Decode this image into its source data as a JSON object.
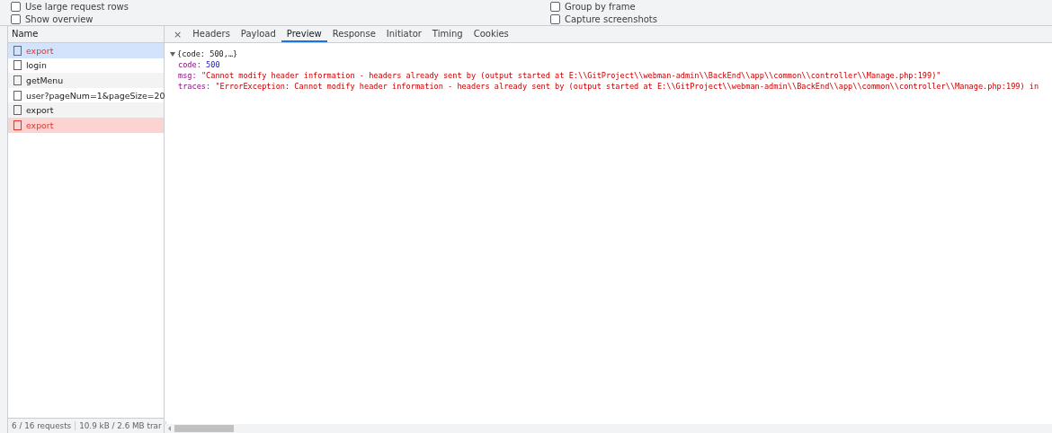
{
  "options": [
    {
      "label": "Use large request rows",
      "checked": false
    },
    {
      "label": "Group by frame",
      "checked": false
    },
    {
      "label": "Show overview",
      "checked": false
    },
    {
      "label": "Capture screenshots",
      "checked": false
    }
  ],
  "requests": {
    "header": "Name",
    "rows": [
      {
        "name": "export",
        "failed": true,
        "selected": true
      },
      {
        "name": "login",
        "failed": false,
        "selected": false
      },
      {
        "name": "getMenu",
        "failed": false,
        "selected": false
      },
      {
        "name": "user?pageNum=1&pageSize=20",
        "failed": false,
        "selected": false
      },
      {
        "name": "export",
        "failed": false,
        "selected": false
      },
      {
        "name": "export",
        "failed": true,
        "selected": false
      }
    ]
  },
  "details": {
    "close": "×",
    "tabs": [
      {
        "label": "Headers",
        "selected": false
      },
      {
        "label": "Payload",
        "selected": false
      },
      {
        "label": "Preview",
        "selected": true
      },
      {
        "label": "Response",
        "selected": false
      },
      {
        "label": "Initiator",
        "selected": false
      },
      {
        "label": "Timing",
        "selected": false
      },
      {
        "label": "Cookies",
        "selected": false
      }
    ],
    "preview": {
      "summary": "{code: 500,…}",
      "expanded": true,
      "entries": [
        {
          "key": "code:",
          "value": "500",
          "kind": "number"
        },
        {
          "key": "msg:",
          "value": "\"Cannot modify header information - headers already sent by (output started at E:\\\\GitProject\\\\webman-admin\\\\BackEnd\\\\app\\\\common\\\\controller\\\\Manage.php:199)\"",
          "kind": "string"
        },
        {
          "key": "traces:",
          "value": "\"ErrorException: Cannot modify header information - headers already sent by (output started at E:\\\\GitProject\\\\webman-admin\\\\BackEnd\\\\app\\\\common\\\\controller\\\\Manage.php:199) in",
          "kind": "string"
        }
      ]
    }
  },
  "status_bar": [
    "6 / 16 requests",
    "10.9 kB / 2.6 MB trar"
  ]
}
